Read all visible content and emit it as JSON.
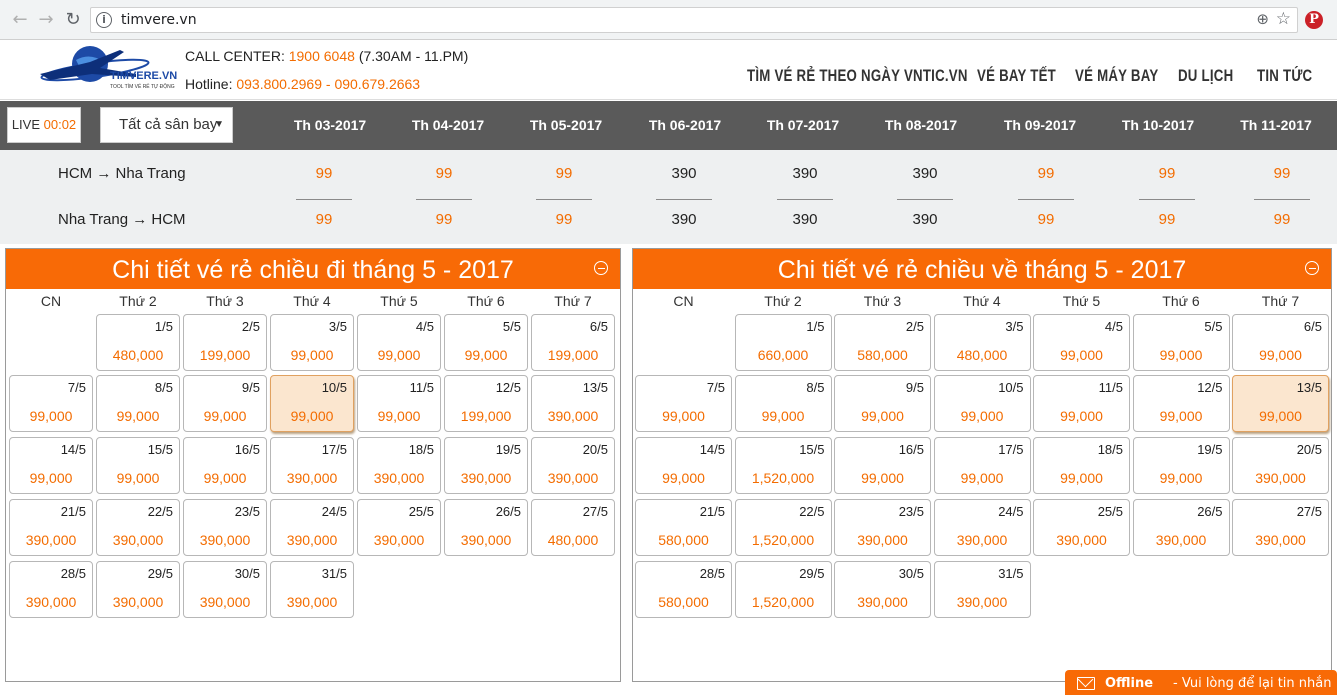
{
  "browser": {
    "url": "timvere.vn"
  },
  "header": {
    "logo_name": "TIMVERE.VN",
    "logo_tagline": "TOOL TÌM VÉ RẺ TỰ ĐỘNG",
    "call_center_label": "CALL CENTER:",
    "call_center_number": "1900 6048",
    "call_center_hours": "(7.30AM - 11.PM)",
    "hotline_label": "Hotline:",
    "hotline_numbers": "093.800.2969 - 090.679.2663",
    "nav": [
      {
        "label": "TÌM VÉ RẺ THEO NGÀY VNTIC.VN"
      },
      {
        "label": "VÉ BAY TẾT"
      },
      {
        "label": "VÉ MÁY BAY"
      },
      {
        "label": "DU LỊCH"
      },
      {
        "label": "TIN TỨC"
      }
    ]
  },
  "toolbar": {
    "live_label": "LIVE",
    "live_time": "00:02",
    "airport_selected": "Tất cả sân bay",
    "months": [
      "Th 03-2017",
      "Th 04-2017",
      "Th 05-2017",
      "Th 06-2017",
      "Th 07-2017",
      "Th 08-2017",
      "Th 09-2017",
      "Th 10-2017",
      "Th 11-2017"
    ]
  },
  "routes": [
    {
      "label": "HCM → Nha Trang",
      "prices": [
        "99",
        "99",
        "99",
        "390",
        "390",
        "390",
        "99",
        "99",
        "99"
      ],
      "cheap": [
        true,
        true,
        true,
        false,
        false,
        false,
        true,
        true,
        true
      ]
    },
    {
      "label": "Nha Trang → HCM",
      "prices": [
        "99",
        "99",
        "99",
        "390",
        "390",
        "390",
        "99",
        "99",
        "99"
      ],
      "cheap": [
        true,
        true,
        true,
        false,
        false,
        false,
        true,
        true,
        true
      ]
    }
  ],
  "weekdays": [
    "CN",
    "Thứ 2",
    "Thứ 3",
    "Thứ 4",
    "Thứ 5",
    "Thứ 6",
    "Thứ 7"
  ],
  "calendars": [
    {
      "title": "Chi tiết vé rẻ chiều đi tháng 5 - 2017",
      "selected": "10/5",
      "days": [
        {
          "date": "1/5",
          "price": "480,000"
        },
        {
          "date": "2/5",
          "price": "199,000"
        },
        {
          "date": "3/5",
          "price": "99,000"
        },
        {
          "date": "4/5",
          "price": "99,000"
        },
        {
          "date": "5/5",
          "price": "99,000"
        },
        {
          "date": "6/5",
          "price": "199,000"
        },
        {
          "date": "7/5",
          "price": "99,000"
        },
        {
          "date": "8/5",
          "price": "99,000"
        },
        {
          "date": "9/5",
          "price": "99,000"
        },
        {
          "date": "10/5",
          "price": "99,000"
        },
        {
          "date": "11/5",
          "price": "99,000"
        },
        {
          "date": "12/5",
          "price": "199,000"
        },
        {
          "date": "13/5",
          "price": "390,000"
        },
        {
          "date": "14/5",
          "price": "99,000"
        },
        {
          "date": "15/5",
          "price": "99,000"
        },
        {
          "date": "16/5",
          "price": "99,000"
        },
        {
          "date": "17/5",
          "price": "390,000"
        },
        {
          "date": "18/5",
          "price": "390,000"
        },
        {
          "date": "19/5",
          "price": "390,000"
        },
        {
          "date": "20/5",
          "price": "390,000"
        },
        {
          "date": "21/5",
          "price": "390,000"
        },
        {
          "date": "22/5",
          "price": "390,000"
        },
        {
          "date": "23/5",
          "price": "390,000"
        },
        {
          "date": "24/5",
          "price": "390,000"
        },
        {
          "date": "25/5",
          "price": "390,000"
        },
        {
          "date": "26/5",
          "price": "390,000"
        },
        {
          "date": "27/5",
          "price": "480,000"
        },
        {
          "date": "28/5",
          "price": "390,000"
        },
        {
          "date": "29/5",
          "price": "390,000"
        },
        {
          "date": "30/5",
          "price": "390,000"
        },
        {
          "date": "31/5",
          "price": "390,000"
        }
      ]
    },
    {
      "title": "Chi tiết vé rẻ chiều về tháng 5 - 2017",
      "selected": "13/5",
      "days": [
        {
          "date": "1/5",
          "price": "660,000"
        },
        {
          "date": "2/5",
          "price": "580,000"
        },
        {
          "date": "3/5",
          "price": "480,000"
        },
        {
          "date": "4/5",
          "price": "99,000"
        },
        {
          "date": "5/5",
          "price": "99,000"
        },
        {
          "date": "6/5",
          "price": "99,000"
        },
        {
          "date": "7/5",
          "price": "99,000"
        },
        {
          "date": "8/5",
          "price": "99,000"
        },
        {
          "date": "9/5",
          "price": "99,000"
        },
        {
          "date": "10/5",
          "price": "99,000"
        },
        {
          "date": "11/5",
          "price": "99,000"
        },
        {
          "date": "12/5",
          "price": "99,000"
        },
        {
          "date": "13/5",
          "price": "99,000"
        },
        {
          "date": "14/5",
          "price": "99,000"
        },
        {
          "date": "15/5",
          "price": "1,520,000"
        },
        {
          "date": "16/5",
          "price": "99,000"
        },
        {
          "date": "17/5",
          "price": "99,000"
        },
        {
          "date": "18/5",
          "price": "99,000"
        },
        {
          "date": "19/5",
          "price": "99,000"
        },
        {
          "date": "20/5",
          "price": "390,000"
        },
        {
          "date": "21/5",
          "price": "580,000"
        },
        {
          "date": "22/5",
          "price": "1,520,000"
        },
        {
          "date": "23/5",
          "price": "390,000"
        },
        {
          "date": "24/5",
          "price": "390,000"
        },
        {
          "date": "25/5",
          "price": "390,000"
        },
        {
          "date": "26/5",
          "price": "390,000"
        },
        {
          "date": "27/5",
          "price": "390,000"
        },
        {
          "date": "28/5",
          "price": "580,000"
        },
        {
          "date": "29/5",
          "price": "1,520,000"
        },
        {
          "date": "30/5",
          "price": "390,000"
        },
        {
          "date": "31/5",
          "price": "390,000"
        }
      ]
    }
  ],
  "chat": {
    "status": "Offline",
    "message": "- Vui lòng để lại tin nhắn"
  },
  "colors": {
    "accent": "#f86a06",
    "price": "#f36c00",
    "bar": "#5a5a5a"
  }
}
